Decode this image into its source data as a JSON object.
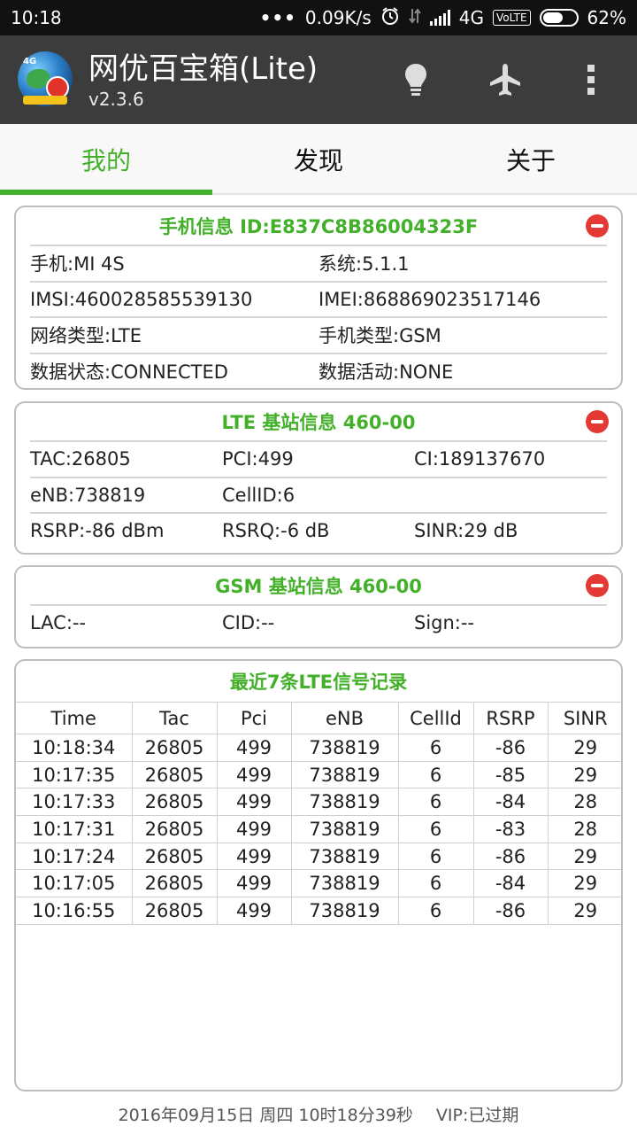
{
  "status_bar": {
    "time": "10:18",
    "dots": "•••",
    "speed": "0.09K/s",
    "network": "4G",
    "volte": "VoLTE",
    "battery": "62%",
    "battery_level": 0.62,
    "icons": [
      "alarm-icon",
      "data-transfer-icon",
      "signal-icon",
      "battery-icon"
    ]
  },
  "app_bar": {
    "title": "网优百宝箱(Lite)",
    "version": "v2.3.6",
    "logo_text": "4G",
    "actions": [
      "lightbulb-icon",
      "airplane-icon",
      "more-vert-icon"
    ]
  },
  "tabs": [
    {
      "label": "我的",
      "active": true
    },
    {
      "label": "发现",
      "active": false
    },
    {
      "label": "关于",
      "active": false
    }
  ],
  "colors": {
    "accent": "#43b02a",
    "app_bar": "#3c3c3c",
    "close": "#e53935"
  },
  "phone_info": {
    "title": "手机信息 ID:E837C8B86004323F",
    "rows": [
      [
        "手机:MI 4S",
        "系统:5.1.1"
      ],
      [
        "IMSI:460028585539130",
        "IMEI:868869023517146"
      ],
      [
        "网络类型:LTE",
        "手机类型:GSM"
      ],
      [
        "数据状态:CONNECTED",
        "数据活动:NONE"
      ]
    ]
  },
  "lte_info": {
    "title": "LTE 基站信息 460-00",
    "rows": [
      [
        "TAC:26805",
        "PCI:499",
        "CI:189137670"
      ],
      [
        "eNB:738819",
        "CellID:6",
        ""
      ],
      [
        "RSRP:-86 dBm",
        "RSRQ:-6 dB",
        "SINR:29 dB"
      ]
    ]
  },
  "gsm_info": {
    "title": "GSM 基站信息 460-00",
    "rows": [
      [
        "LAC:--",
        "CID:--",
        "Sign:--"
      ]
    ]
  },
  "records": {
    "title": "最近7条LTE信号记录",
    "headers": [
      "Time",
      "Tac",
      "Pci",
      "eNB",
      "CellId",
      "RSRP",
      "SINR"
    ],
    "rows": [
      [
        "10:18:34",
        "26805",
        "499",
        "738819",
        "6",
        "-86",
        "29"
      ],
      [
        "10:17:35",
        "26805",
        "499",
        "738819",
        "6",
        "-85",
        "29"
      ],
      [
        "10:17:33",
        "26805",
        "499",
        "738819",
        "6",
        "-84",
        "28"
      ],
      [
        "10:17:31",
        "26805",
        "499",
        "738819",
        "6",
        "-83",
        "28"
      ],
      [
        "10:17:24",
        "26805",
        "499",
        "738819",
        "6",
        "-86",
        "29"
      ],
      [
        "10:17:05",
        "26805",
        "499",
        "738819",
        "6",
        "-84",
        "29"
      ],
      [
        "10:16:55",
        "26805",
        "499",
        "738819",
        "6",
        "-86",
        "29"
      ]
    ]
  },
  "footer": {
    "datetime": "2016年09月15日 周四 10时18分39秒",
    "vip": "VIP:已过期"
  }
}
